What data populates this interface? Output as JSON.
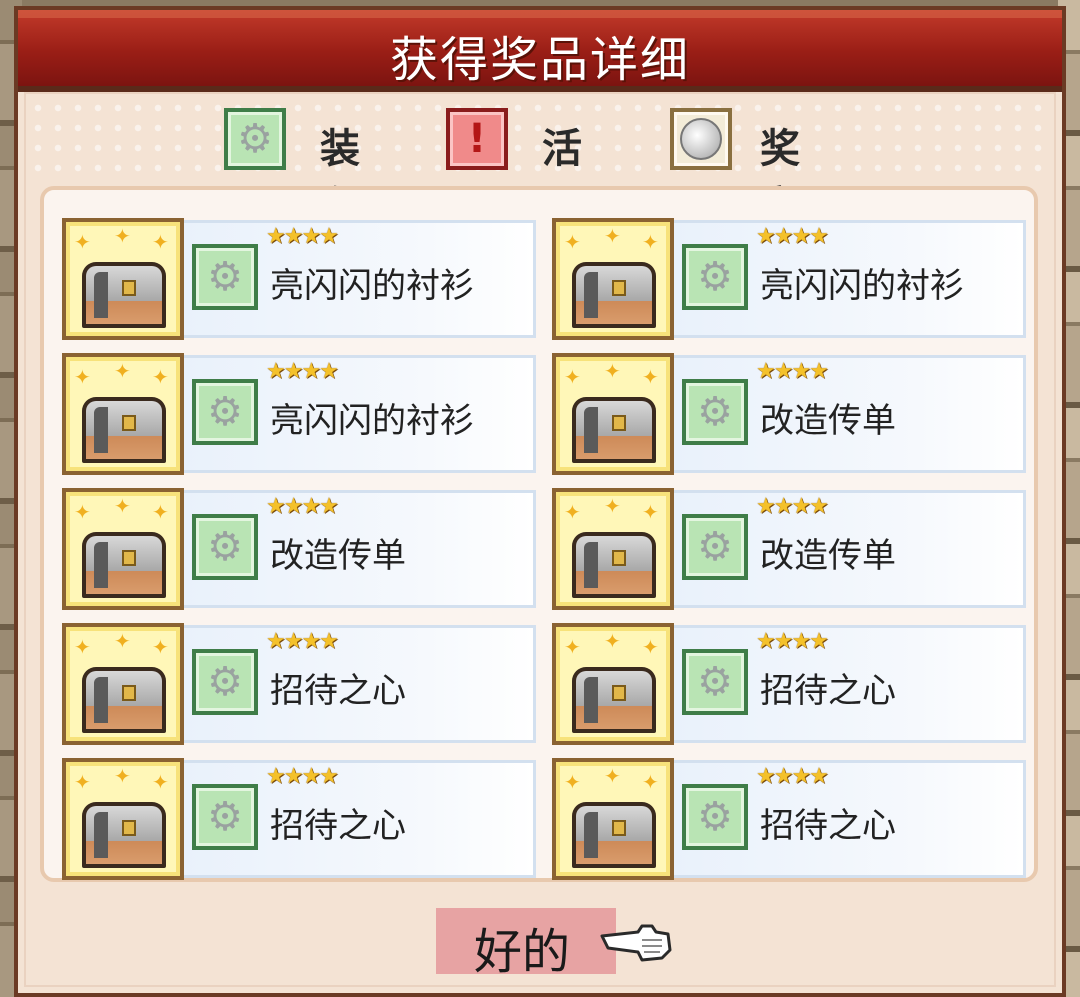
{
  "dialog": {
    "title": "获得奖品详细"
  },
  "legend": [
    {
      "label": "装备",
      "icon": "gear-icon",
      "color": "#b9e4b4"
    },
    {
      "label": "活动",
      "icon": "exclamation-icon",
      "color": "#f08a8a"
    },
    {
      "label": "奖章",
      "icon": "medal-icon",
      "color": "#f3ecd8"
    }
  ],
  "stars_text": "★★★★",
  "rewards": [
    {
      "name": "亮闪闪的衬衫",
      "icon": "treasure-chest-icon",
      "category_icon": "gear-icon",
      "stars": 4
    },
    {
      "name": "亮闪闪的衬衫",
      "icon": "treasure-chest-icon",
      "category_icon": "gear-icon",
      "stars": 4
    },
    {
      "name": "亮闪闪的衬衫",
      "icon": "treasure-chest-icon",
      "category_icon": "gear-icon",
      "stars": 4
    },
    {
      "name": "改造传单",
      "icon": "treasure-chest-icon",
      "category_icon": "gear-icon",
      "stars": 4
    },
    {
      "name": "改造传单",
      "icon": "treasure-chest-icon",
      "category_icon": "gear-icon",
      "stars": 4
    },
    {
      "name": "改造传单",
      "icon": "treasure-chest-icon",
      "category_icon": "gear-icon",
      "stars": 4
    },
    {
      "name": "招待之心",
      "icon": "treasure-chest-icon",
      "category_icon": "gear-icon",
      "stars": 4
    },
    {
      "name": "招待之心",
      "icon": "treasure-chest-icon",
      "category_icon": "gear-icon",
      "stars": 4
    },
    {
      "name": "招待之心",
      "icon": "treasure-chest-icon",
      "category_icon": "gear-icon",
      "stars": 4
    },
    {
      "name": "招待之心",
      "icon": "treasure-chest-icon",
      "category_icon": "gear-icon",
      "stars": 4
    }
  ],
  "ok_button": {
    "label": "好的",
    "icon": "pointing-hand-icon"
  }
}
